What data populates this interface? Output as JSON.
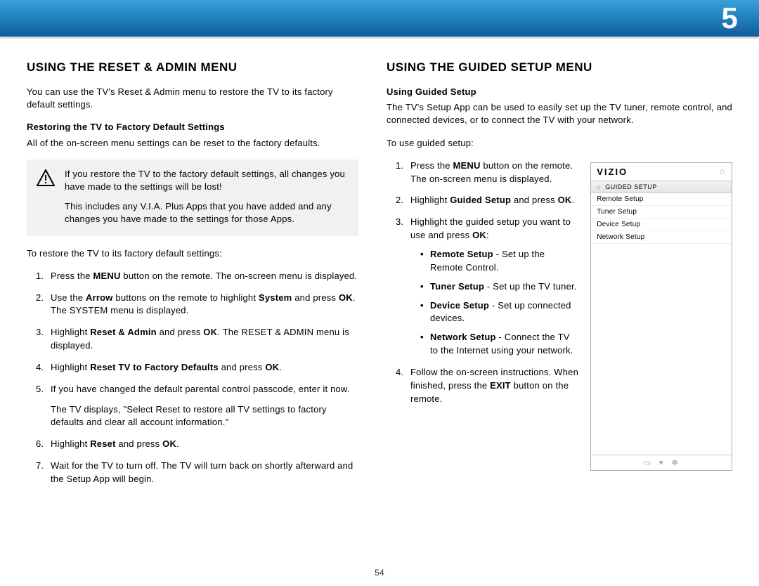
{
  "chapter": "5",
  "pageNumber": "54",
  "left": {
    "heading": "USING THE RESET & ADMIN MENU",
    "intro": "You can use the TV's Reset & Admin menu to restore the TV to its factory default settings.",
    "sub1": "Restoring the TV to Factory Default Settings",
    "sub1text": "All of the on-screen menu settings can be reset to the factory defaults.",
    "note1": "If you restore the TV to the factory default settings, all changes you have made to the settings will be lost!",
    "note2": "This includes any V.I.A. Plus Apps that you have added and any changes you have made to the settings for those Apps.",
    "lead": "To restore the TV to its factory default settings:",
    "steps": {
      "s1a": "Press the ",
      "s1b": "MENU",
      "s1c": " button on the remote. The on-screen menu is displayed.",
      "s2a": "Use the ",
      "s2b": "Arrow",
      "s2c": " buttons on the remote to highlight ",
      "s2d": "System",
      "s2e": " and press ",
      "s2f": "OK",
      "s2g": ". The SYSTEM menu is displayed.",
      "s3a": "Highlight ",
      "s3b": "Reset & Admin",
      "s3c": " and press ",
      "s3d": "OK",
      "s3e": ". The RESET & ADMIN menu is displayed.",
      "s4a": "Highlight ",
      "s4b": "Reset TV to Factory Defaults",
      "s4c": " and press ",
      "s4d": "OK",
      "s4e": ".",
      "s5": "If you have changed the default parental control passcode, enter it now.",
      "s5aft": "The TV displays, \"Select Reset to restore all TV settings to factory defaults and clear all account information.\"",
      "s6a": "Highlight ",
      "s6b": "Reset",
      "s6c": " and press ",
      "s6d": "OK",
      "s6e": ".",
      "s7": "Wait for the TV to turn off. The TV will turn back on shortly afterward and the Setup App will begin."
    }
  },
  "right": {
    "heading": "USING THE GUIDED SETUP MENU",
    "sub": "Using Guided Setup",
    "intro": "The TV's Setup App can be used to easily set up the TV tuner, remote control, and connected devices, or to connect the TV with your network.",
    "lead": "To use guided setup:",
    "s1a": "Press the ",
    "s1b": "MENU",
    "s1c": " button on the remote. The on-screen menu is displayed.",
    "s2a": "Highlight ",
    "s2b": "Guided Setup",
    "s2c": " and press ",
    "s2d": "OK",
    "s2e": ".",
    "s3a": "Highlight the guided setup you want to use and press ",
    "s3b": "OK",
    "s3c": ":",
    "b1a": "Remote Setup",
    "b1b": " - Set up the Remote Control.",
    "b2a": "Tuner Setup",
    "b2b": " - Set up the TV tuner.",
    "b3a": "Device Setup",
    "b3b": " - Set up connected devices.",
    "b4a": "Network Setup",
    "b4b": " - Connect the TV to the Internet using your network.",
    "s4a": "Follow the on-screen instructions. When finished, press the ",
    "s4b": "EXIT",
    "s4c": " button on the remote."
  },
  "osd": {
    "brand": "VIZIO",
    "crumb": "GUIDED SETUP",
    "items": [
      "Remote Setup",
      "Tuner Setup",
      "Device Setup",
      "Network Setup"
    ]
  }
}
